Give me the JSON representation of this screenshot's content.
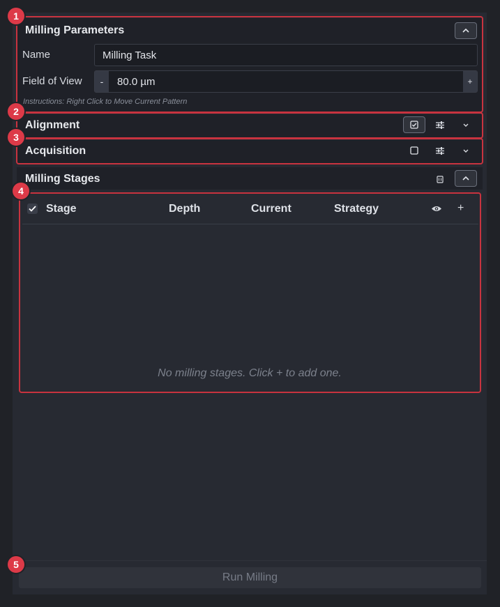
{
  "milling_parameters": {
    "title": "Milling Parameters",
    "name_label": "Name",
    "name_value": "Milling Task",
    "fov_label": "Field of View",
    "fov_minus": "-",
    "fov_value": "80.0  µm",
    "fov_plus": "+",
    "instructions": "Instructions: Right Click to Move Current Pattern"
  },
  "alignment": {
    "title": "Alignment",
    "checked": true
  },
  "acquisition": {
    "title": "Acquisition",
    "checked": false
  },
  "milling_stages": {
    "title": "Milling Stages",
    "columns": [
      "Stage",
      "Depth",
      "Current",
      "Strategy"
    ],
    "add_label": "+",
    "empty_message": "No milling stages. Click + to add one."
  },
  "run_button_label": "Run Milling",
  "badges": [
    "1",
    "2",
    "3",
    "4",
    "5"
  ],
  "colors": {
    "panel_bg": "#272a32",
    "highlight_border": "#c8333f",
    "badge_bg": "#dd3a48"
  }
}
